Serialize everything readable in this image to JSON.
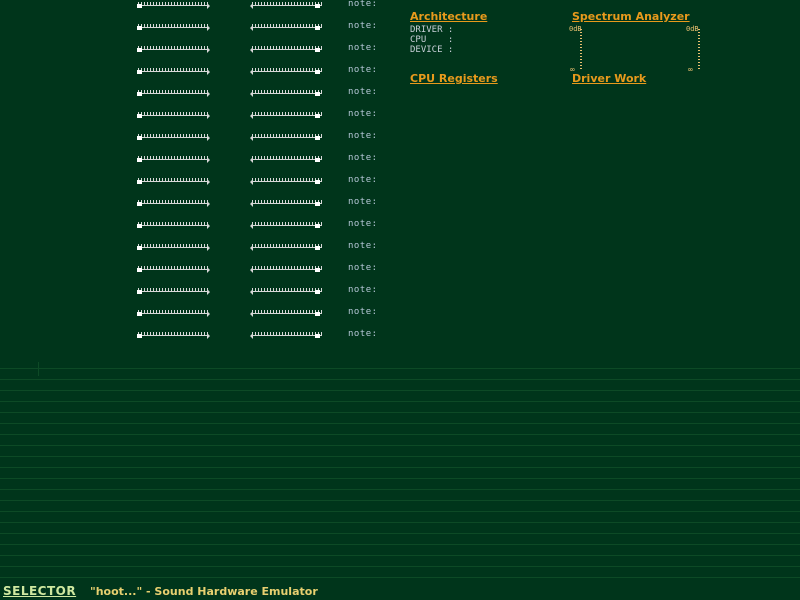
{
  "channels": {
    "note_label": "note:",
    "rows": [
      {
        "vol": 0.0,
        "pan": 1.0
      },
      {
        "vol": 0.0,
        "pan": 1.0
      },
      {
        "vol": 0.0,
        "pan": 1.0
      },
      {
        "vol": 0.0,
        "pan": 1.0
      },
      {
        "vol": 0.0,
        "pan": 1.0
      },
      {
        "vol": 0.0,
        "pan": 1.0
      },
      {
        "vol": 0.0,
        "pan": 1.0
      },
      {
        "vol": 0.0,
        "pan": 1.0
      },
      {
        "vol": 0.0,
        "pan": 1.0
      },
      {
        "vol": 0.0,
        "pan": 1.0
      },
      {
        "vol": 0.0,
        "pan": 1.0
      },
      {
        "vol": 0.0,
        "pan": 1.0
      },
      {
        "vol": 0.0,
        "pan": 1.0
      },
      {
        "vol": 0.0,
        "pan": 1.0
      },
      {
        "vol": 0.0,
        "pan": 1.0
      },
      {
        "vol": 0.0,
        "pan": 1.0
      }
    ]
  },
  "architecture": {
    "title": "Architecture",
    "labels": [
      "DRIVER :",
      "CPU    :",
      "DEVICE :"
    ]
  },
  "spectrum": {
    "title": "Spectrum Analyzer",
    "top_label": "0dB",
    "bottom_label": "∞"
  },
  "cpu_registers": {
    "title": "CPU Registers"
  },
  "driver_work": {
    "title": "Driver Work"
  },
  "status": {
    "selector": "SELECTOR",
    "app_title": "\"hoot...\" - Sound Hardware Emulator"
  },
  "colors": {
    "background": "#00351b",
    "accent": "#e89a1c",
    "text": "#c8d0d8"
  }
}
